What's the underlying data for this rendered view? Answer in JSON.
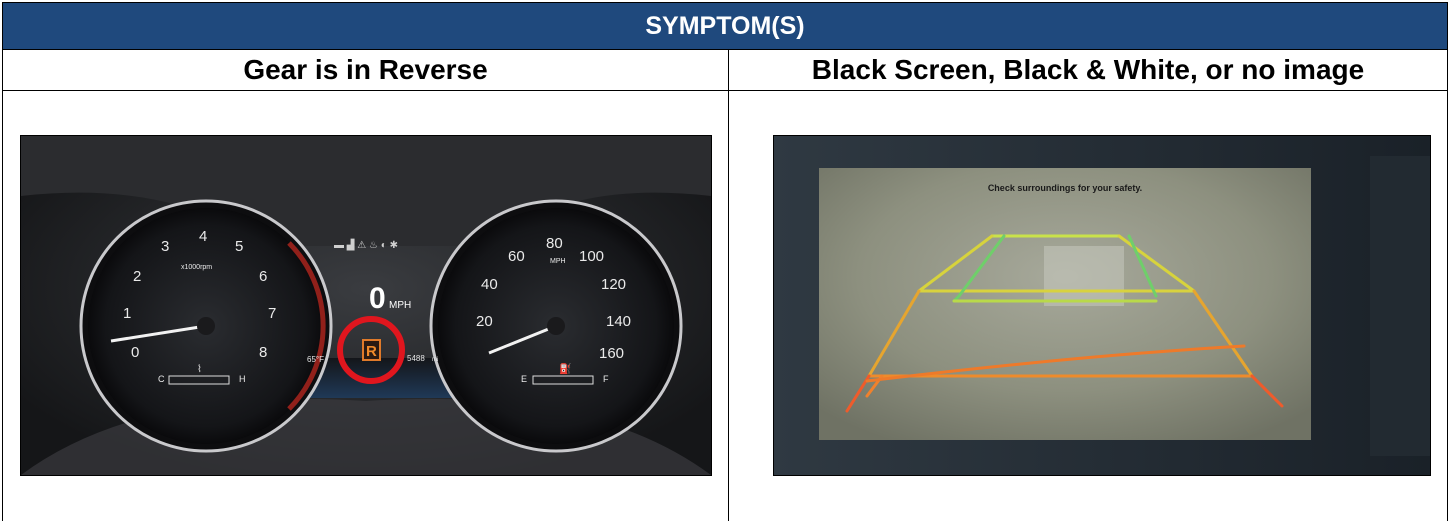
{
  "table": {
    "header": "SYMPTOM(S)",
    "columns": [
      {
        "title": "Gear is in Reverse"
      },
      {
        "title": "Black Screen, Black & White, or no image"
      }
    ]
  },
  "cluster_photo": {
    "tach_numbers": [
      "0",
      "1",
      "2",
      "3",
      "4",
      "5",
      "6",
      "7",
      "8"
    ],
    "tach_unit": "x1000rpm",
    "speed_numbers": [
      "20",
      "40",
      "60",
      "80",
      "100",
      "120",
      "140",
      "160"
    ],
    "speed_unit": "MPH",
    "speed_value": "0",
    "speed_value_unit": "MPH",
    "gear": "R",
    "outside_temp": "65°F",
    "odometer": "5488",
    "odometer_unit": "mi",
    "temp_cold": "C",
    "temp_hot": "H",
    "fuel_empty": "E",
    "fuel_full": "F",
    "highlight_color": "#e0161e"
  },
  "camera_photo": {
    "message": "Check surroundings for your safety."
  }
}
